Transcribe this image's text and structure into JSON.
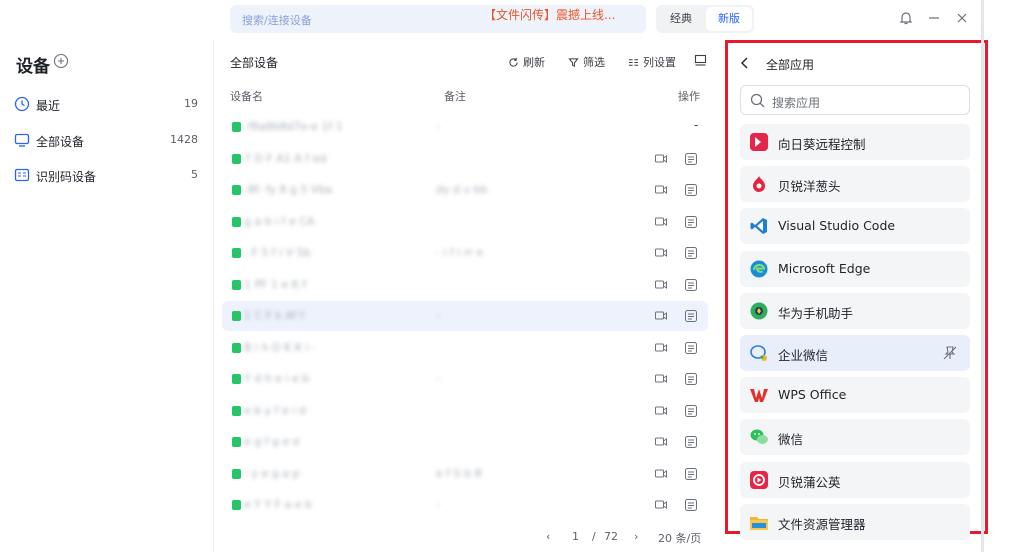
{
  "header": {
    "search_placeholder": "搜索/连接设备",
    "promo": "【文件闪传】震撼上线...",
    "modes": [
      "经典",
      "新版"
    ],
    "active_mode": "新版"
  },
  "nav": {
    "title": "设备",
    "items": [
      {
        "label": "最近",
        "count": "19"
      },
      {
        "label": "全部设备",
        "count": "1428"
      },
      {
        "label": "识别码设备",
        "count": "5"
      }
    ]
  },
  "list": {
    "title": "全部设备",
    "tools": [
      "刷新",
      "筛选",
      "列设置"
    ],
    "columns": [
      "设备名",
      "备注",
      "操作"
    ],
    "rows": [
      {
        "name": "-f8a8b8d7e-e  1f 1",
        "note": "-",
        "ops": "-"
      },
      {
        "name": "7  D  F A1  A  f  ed",
        "note": "",
        "ops": "icons"
      },
      {
        "name": "-8f-  fy  8  g  5  Vba",
        "note": "dy  d  v  bb",
        "ops": "icons"
      },
      {
        "name": "  g  a  b  i  f  e  CA",
        "note": "",
        "ops": "icons"
      },
      {
        "name": "-  F  5  f  i  V  Sb",
        "note": "-  i  f  i  rr  e",
        "ops": "icons"
      },
      {
        "name": "   1  PF  1  e  K  f",
        "note": "",
        "ops": "icons"
      },
      {
        "name": "  1  C  F  k  Af  f",
        "note": "-",
        "ops": "icons"
      },
      {
        "name": "  B  i  h  D  K  K  i  -",
        "note": "",
        "ops": "icons"
      },
      {
        "name": "  Y  d  h  e  i  e  b",
        "note": "-",
        "ops": "icons"
      },
      {
        "name": "  e  b  y  f  e  i  d",
        "note": "",
        "ops": "icons"
      },
      {
        "name": "  e  g  f  g  e  e",
        "note": "",
        "ops": "icons"
      },
      {
        "name": "-  y  e  g  a  p",
        "note": "e  f  S  b  8",
        "ops": "icons"
      },
      {
        "name": "  e  Y  Y  F  a  e  b",
        "note": "-",
        "ops": "icons"
      }
    ],
    "pager": {
      "page": "1",
      "separator": "/",
      "total": "72",
      "per_page": "20 条/页"
    }
  },
  "apps": {
    "title": "全部应用",
    "search_placeholder": "搜索应用",
    "items": [
      {
        "label": "向日葵远程控制",
        "icon": "sunlogin-icon",
        "color": "#e5264a"
      },
      {
        "label": "贝锐洋葱头",
        "icon": "onion-icon",
        "color": "#e8233f"
      },
      {
        "label": "Visual Studio Code",
        "icon": "vscode-icon",
        "color": "#1b7fd4"
      },
      {
        "label": "Microsoft Edge",
        "icon": "edge-icon",
        "color": "#1c8ed6"
      },
      {
        "label": "华为手机助手",
        "icon": "huawei-assistant-icon",
        "color": "#2fae5a"
      },
      {
        "label": "企业微信",
        "icon": "wecom-icon",
        "color": "#2b7be8"
      },
      {
        "label": "WPS Office",
        "icon": "wps-icon",
        "color": "#e0312a"
      },
      {
        "label": "微信",
        "icon": "wechat-icon",
        "color": "#2ec05a"
      },
      {
        "label": "贝锐蒲公英",
        "icon": "dandelion-icon",
        "color": "#e5264a"
      },
      {
        "label": "文件资源管理器",
        "icon": "explorer-icon",
        "color": "#f2b630"
      }
    ],
    "selected_index": 5
  }
}
